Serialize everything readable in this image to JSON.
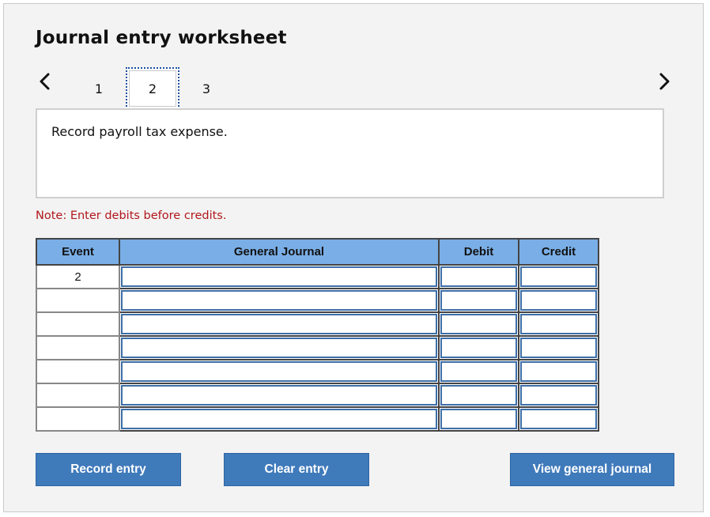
{
  "worksheet": {
    "title": "Journal entry worksheet",
    "steps": [
      "1",
      "2",
      "3"
    ],
    "active_step": "2",
    "instruction": "Record payroll tax expense.",
    "note": "Note: Enter debits before credits."
  },
  "nav": {
    "prev_icon": "chevron-left-icon",
    "next_icon": "chevron-right-icon"
  },
  "table": {
    "headers": {
      "event": "Event",
      "general_journal": "General Journal",
      "debit": "Debit",
      "credit": "Credit"
    },
    "rows": [
      {
        "event": "2",
        "account": "",
        "debit": "",
        "credit": ""
      },
      {
        "event": "",
        "account": "",
        "debit": "",
        "credit": ""
      },
      {
        "event": "",
        "account": "",
        "debit": "",
        "credit": ""
      },
      {
        "event": "",
        "account": "",
        "debit": "",
        "credit": ""
      },
      {
        "event": "",
        "account": "",
        "debit": "",
        "credit": ""
      },
      {
        "event": "",
        "account": "",
        "debit": "",
        "credit": ""
      },
      {
        "event": "",
        "account": "",
        "debit": "",
        "credit": ""
      }
    ]
  },
  "buttons": {
    "record": "Record entry",
    "clear": "Clear entry",
    "view": "View general journal"
  },
  "colors": {
    "header_bg": "#7aaee6",
    "button_bg": "#3f7abb",
    "note_text": "#b1171c",
    "input_border": "#3d6fa8"
  }
}
